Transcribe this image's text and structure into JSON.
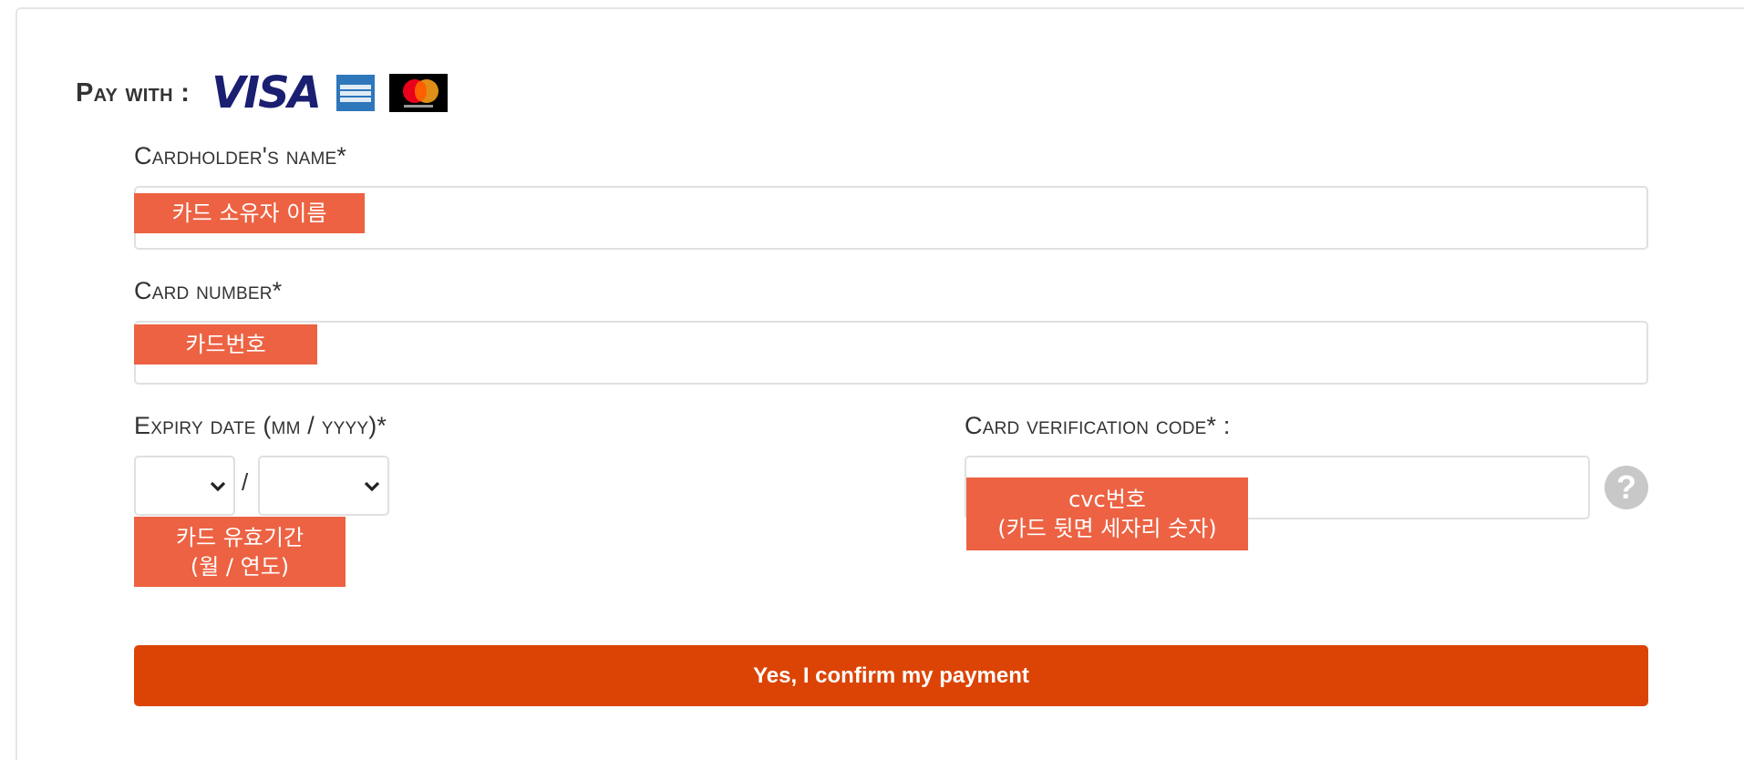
{
  "payment": {
    "pay_with_label": "Pay with :",
    "card_brands": {
      "visa": "VISA",
      "amex_icon": "amex-icon",
      "mastercard_icon": "mastercard-icon"
    },
    "cardholder_name": {
      "label": "Cardholder's name*",
      "value": "",
      "annotation": "카드 소유자 이름"
    },
    "card_number": {
      "label": "Card number*",
      "value": "",
      "annotation": "카드번호"
    },
    "expiry": {
      "label": "Expiry date (mm / yyyy)*",
      "month_selected": "",
      "year_selected": "",
      "separator": "/",
      "annotation": "카드 유효기간\n(월 / 연도)"
    },
    "cvc": {
      "label": "Card verification code* :",
      "value": "",
      "help_symbol": "?",
      "annotation": "cvc번호\n(카드 뒷면 세자리 숫자)"
    },
    "confirm_button_label": "Yes, I confirm my payment"
  },
  "colors": {
    "accent_button": "#dc4405",
    "annotation_overlay": "#ec6243",
    "visa_blue": "#1a1f71",
    "amex_blue": "#2e77bb"
  }
}
